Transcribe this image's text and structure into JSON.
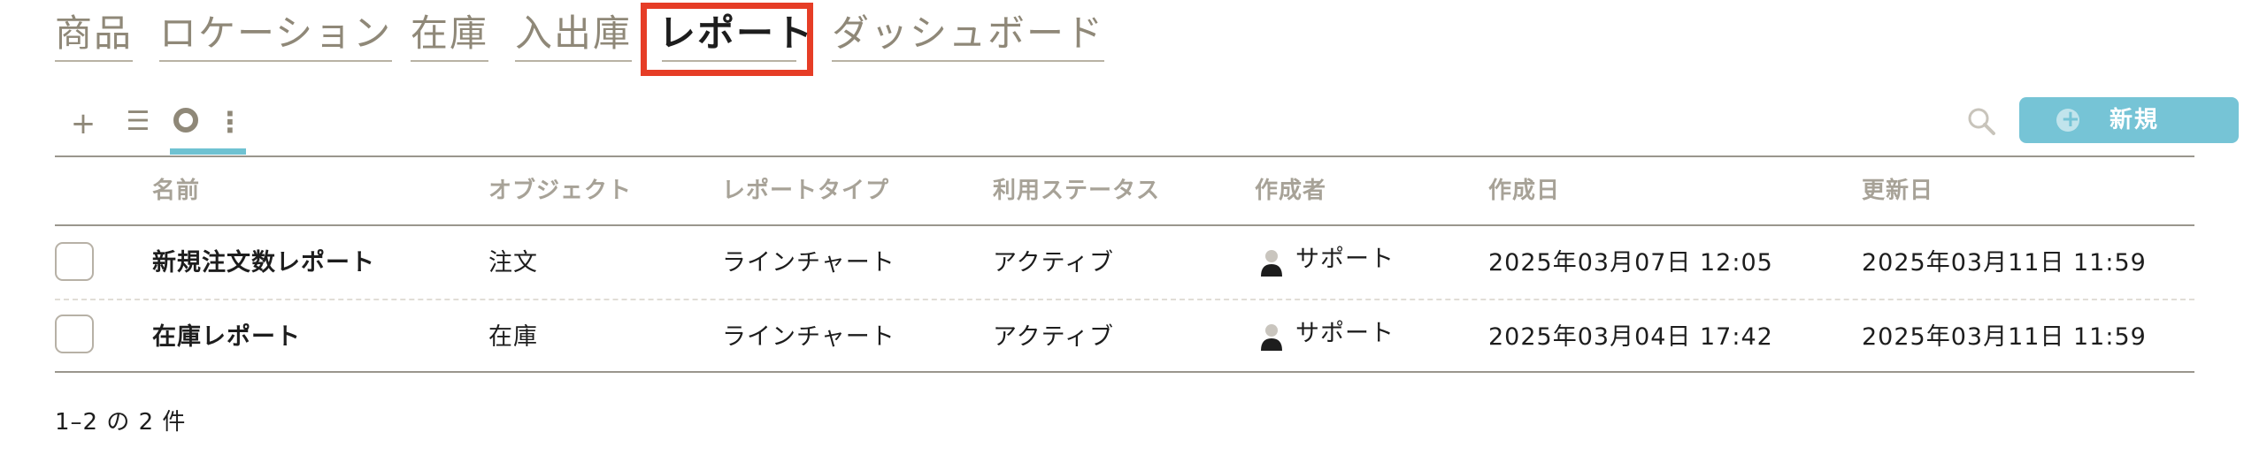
{
  "nav": {
    "tabs": [
      {
        "label": "商品"
      },
      {
        "label": "ロケーション"
      },
      {
        "label": "在庫"
      },
      {
        "label": "入出庫"
      },
      {
        "label": "レポート"
      },
      {
        "label": "ダッシュボード"
      }
    ],
    "active_tab": "レポート"
  },
  "toolbar": {
    "add_glyph": "+",
    "list_glyph": "☰",
    "more_glyph": "⋮",
    "new_button_label": "新規",
    "accent_color": "#76c4d6"
  },
  "table": {
    "columns": [
      "名前",
      "オブジェクト",
      "レポートタイプ",
      "利用ステータス",
      "作成者",
      "作成日",
      "更新日"
    ],
    "rows": [
      {
        "name": "新規注文数レポート",
        "object": "注文",
        "report_type": "ラインチャート",
        "status": "アクティブ",
        "creator": "サポート",
        "created": "2025年03月07日 12:05",
        "updated": "2025年03月11日 11:59"
      },
      {
        "name": "在庫レポート",
        "object": "在庫",
        "report_type": "ラインチャート",
        "status": "アクティブ",
        "creator": "サポート",
        "created": "2025年03月04日 17:42",
        "updated": "2025年03月11日 11:59"
      }
    ]
  },
  "footer": {
    "pagination": "1–2 の 2 件"
  }
}
